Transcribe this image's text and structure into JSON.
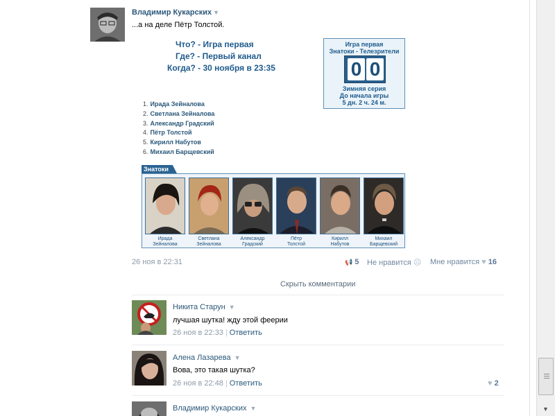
{
  "post": {
    "author": "Владимир Кукарских",
    "text": "...а на деле Пётр Толстой.",
    "quiz": {
      "line1": "Что? - Игра первая",
      "line2": "Где? - Первый канал",
      "line3": "Когда? - 30 ноября в 23:35"
    },
    "timer": {
      "title": "Игра первая",
      "teams": "Знатоки - Телезрители",
      "score_left": "0",
      "score_right": "0",
      "series": "Зимняя серия",
      "until": "До начала игры",
      "remaining": "5 дн. 2 ч. 24 м."
    },
    "players": [
      {
        "num": "1.",
        "name": "Ирада Зейналова"
      },
      {
        "num": "2.",
        "name": "Светлана Зейналова"
      },
      {
        "num": "3.",
        "name": "Александр Градский"
      },
      {
        "num": "4.",
        "name": "Пётр Толстой"
      },
      {
        "num": "5.",
        "name": "Кирилл Набутов"
      },
      {
        "num": "6.",
        "name": "Михаил Барщевский"
      }
    ],
    "team_tab": "Знатоки",
    "team_photos": [
      {
        "first": "Ирада",
        "last": "Зейналова"
      },
      {
        "first": "Светлана",
        "last": "Зейналова"
      },
      {
        "first": "Александр",
        "last": "Градский"
      },
      {
        "first": "Пётр",
        "last": "Толстой"
      },
      {
        "first": "Кирилл",
        "last": "Набутов"
      },
      {
        "first": "Михаил",
        "last": "Барщевский"
      }
    ],
    "date": "26 ноя в 22:31",
    "share_count": "5",
    "dislike_label": "Не нравится",
    "like_label": "Мне нравится",
    "like_count": "16",
    "hide_comments": "Скрыть комментарии"
  },
  "comments": [
    {
      "author": "Никита Старун",
      "text": "лучшая шутка! ждy этой феерии",
      "date": "26 ноя в 22:33",
      "reply": "Ответить",
      "likes": ""
    },
    {
      "author": "Алена Лазарева",
      "text": "Вова, это такая шутка?",
      "date": "26 ноя в 22:48",
      "reply": "Ответить",
      "likes": "2"
    },
    {
      "author": "Владимир Кукарских",
      "text": "",
      "date": "",
      "reply": "",
      "likes": ""
    }
  ],
  "icons": {
    "caret": "▼",
    "share": "📢",
    "dislike": "☹",
    "heart": "♥"
  }
}
